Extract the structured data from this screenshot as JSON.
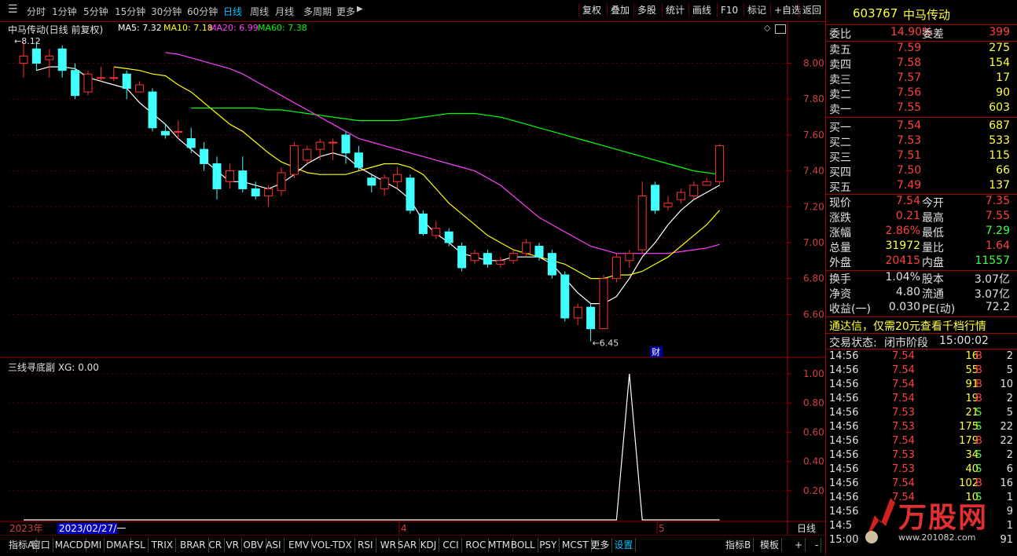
{
  "toolbar": {
    "periods": [
      "分时",
      "1分钟",
      "5分钟",
      "15分钟",
      "30分钟",
      "60分钟",
      "日线",
      "周线",
      "月线",
      "多周期",
      "更多"
    ],
    "active_period": "日线",
    "right_buttons": [
      "复权",
      "叠加",
      "多股",
      "统计",
      "画线",
      "F10",
      "标记",
      "+自选",
      "返回"
    ]
  },
  "chart": {
    "title": "中马传动(日线 前复权)",
    "ma_labels": [
      {
        "text": "MA5: 7.32",
        "color": "#ffffff"
      },
      {
        "text": "MA10: 7.18",
        "color": "#ffff00"
      },
      {
        "text": "MA20: 6.99",
        "color": "#ff40ff"
      },
      {
        "text": "MA60: 7.38",
        "color": "#00ff00"
      }
    ],
    "high_marker": "8.12",
    "low_marker": "6.45",
    "fin_marker": "财",
    "price_ticks": [
      "8.00",
      "7.80",
      "7.60",
      "7.40",
      "7.20",
      "7.00",
      "6.80",
      "6.60"
    ],
    "indicator_title": "三线寻底副 XG: 0.00",
    "ind_ticks": [
      "1.00",
      "0.80",
      "0.60",
      "0.40",
      "0.20"
    ],
    "date_year": "2023年",
    "date_cursor": "2023/02/27/一",
    "month_labels": [
      "4",
      "5"
    ],
    "period_tag": "日线",
    "chart_data": {
      "type": "candlestick",
      "ylim": [
        6.4,
        8.16
      ],
      "candles": [
        [
          8.0,
          8.04,
          7.92,
          8.12
        ],
        [
          8.08,
          8.0,
          7.96,
          8.12
        ],
        [
          8.02,
          8.04,
          7.92,
          8.08
        ],
        [
          8.08,
          7.96,
          7.92,
          8.1
        ],
        [
          7.96,
          7.82,
          7.8,
          8.0
        ],
        [
          7.84,
          7.94,
          7.82,
          7.96
        ],
        [
          7.92,
          7.92,
          7.9,
          7.98
        ],
        [
          7.92,
          7.92,
          7.9,
          7.98
        ],
        [
          7.94,
          7.86,
          7.8,
          7.96
        ],
        [
          7.84,
          7.88,
          7.84,
          7.9
        ],
        [
          7.84,
          7.64,
          7.62,
          7.86
        ],
        [
          7.62,
          7.6,
          7.58,
          7.66
        ],
        [
          7.62,
          7.62,
          7.58,
          7.68
        ],
        [
          7.58,
          7.53,
          7.5,
          7.64
        ],
        [
          7.52,
          7.44,
          7.4,
          7.56
        ],
        [
          7.44,
          7.3,
          7.24,
          7.48
        ],
        [
          7.34,
          7.4,
          7.3,
          7.44
        ],
        [
          7.4,
          7.3,
          7.28,
          7.48
        ],
        [
          7.3,
          7.26,
          7.24,
          7.34
        ],
        [
          7.26,
          7.3,
          7.2,
          7.32
        ],
        [
          7.29,
          7.39,
          7.26,
          7.42
        ],
        [
          7.38,
          7.54,
          7.36,
          7.56
        ],
        [
          7.46,
          7.52,
          7.44,
          7.54
        ],
        [
          7.52,
          7.56,
          7.46,
          7.58
        ],
        [
          7.56,
          7.56,
          7.46,
          7.58
        ],
        [
          7.6,
          7.5,
          7.44,
          7.62
        ],
        [
          7.5,
          7.42,
          7.4,
          7.54
        ],
        [
          7.36,
          7.32,
          7.28,
          7.38
        ],
        [
          7.3,
          7.36,
          7.26,
          7.38
        ],
        [
          7.34,
          7.38,
          7.3,
          7.42
        ],
        [
          7.36,
          7.18,
          7.16,
          7.38
        ],
        [
          7.16,
          7.05,
          7.04,
          7.18
        ],
        [
          7.04,
          7.08,
          7.02,
          7.12
        ],
        [
          7.06,
          7.0,
          6.98,
          7.08
        ],
        [
          6.98,
          6.86,
          6.84,
          7.0
        ],
        [
          6.9,
          6.94,
          6.88,
          6.96
        ],
        [
          6.94,
          6.88,
          6.86,
          6.96
        ],
        [
          6.88,
          6.9,
          6.86,
          6.92
        ],
        [
          6.9,
          6.94,
          6.88,
          6.96
        ],
        [
          6.94,
          7.0,
          6.92,
          7.02
        ],
        [
          6.98,
          6.92,
          6.9,
          7.0
        ],
        [
          6.94,
          6.82,
          6.8,
          6.96
        ],
        [
          6.82,
          6.58,
          6.56,
          6.84
        ],
        [
          6.58,
          6.64,
          6.54,
          6.66
        ],
        [
          6.64,
          6.52,
          6.45,
          6.66
        ],
        [
          6.52,
          6.8,
          6.52,
          6.82
        ],
        [
          6.8,
          6.92,
          6.78,
          6.94
        ],
        [
          6.9,
          6.94,
          6.86,
          6.96
        ],
        [
          6.96,
          7.26,
          6.94,
          7.34
        ],
        [
          7.32,
          7.18,
          7.16,
          7.34
        ],
        [
          7.2,
          7.22,
          7.18,
          7.26
        ],
        [
          7.24,
          7.28,
          7.22,
          7.3
        ],
        [
          7.26,
          7.32,
          7.24,
          7.34
        ],
        [
          7.32,
          7.34,
          7.32,
          7.36
        ],
        [
          7.34,
          7.54,
          7.32,
          7.55
        ]
      ],
      "ma5": [
        7.96,
        7.98,
        7.98,
        7.97,
        7.92,
        7.9,
        7.88,
        7.86,
        7.78,
        7.72,
        7.66,
        7.58,
        7.52,
        7.46,
        7.4,
        7.34,
        7.34,
        7.32,
        7.3,
        7.33,
        7.38,
        7.44,
        7.48,
        7.5,
        7.48,
        7.42,
        7.38,
        7.34,
        7.3,
        7.24,
        7.12,
        7.05,
        7.0,
        6.94,
        6.92,
        6.9,
        6.9,
        6.92,
        6.92,
        6.92,
        6.88,
        6.8,
        6.72,
        6.66,
        6.66,
        6.7,
        6.8,
        6.92,
        7.0,
        7.1,
        7.18,
        7.24,
        7.28,
        7.32
      ],
      "ma10": [
        7.98,
        7.97,
        7.96,
        7.94,
        7.93,
        7.88,
        7.84,
        7.78,
        7.72,
        7.66,
        7.62,
        7.56,
        7.5,
        7.45,
        7.42,
        7.39,
        7.38,
        7.38,
        7.38,
        7.4,
        7.42,
        7.44,
        7.44,
        7.42,
        7.38,
        7.3,
        7.22,
        7.16,
        7.1,
        7.04,
        7.0,
        6.96,
        6.94,
        6.92,
        6.9,
        6.88,
        6.84,
        6.8,
        6.8,
        6.82,
        6.82,
        6.84,
        6.88,
        6.92,
        6.98,
        7.04,
        7.1,
        7.18
      ],
      "ma20": [
        8.06,
        8.05,
        8.03,
        8.01,
        7.99,
        7.97,
        7.94,
        7.9,
        7.86,
        7.82,
        7.78,
        7.74,
        7.7,
        7.66,
        7.62,
        7.58,
        7.56,
        7.54,
        7.52,
        7.5,
        7.48,
        7.46,
        7.44,
        7.42,
        7.4,
        7.36,
        7.32,
        7.26,
        7.2,
        7.14,
        7.1,
        7.06,
        7.02,
        6.98,
        6.96,
        6.94,
        6.94,
        6.94,
        6.94,
        6.94,
        6.95,
        6.96,
        6.97,
        6.99
      ],
      "ma60": [
        7.75,
        7.75,
        7.75,
        7.75,
        7.75,
        7.75,
        7.74,
        7.74,
        7.73,
        7.72,
        7.71,
        7.7,
        7.69,
        7.68,
        7.68,
        7.68,
        7.68,
        7.69,
        7.7,
        7.71,
        7.72,
        7.72,
        7.72,
        7.71,
        7.7,
        7.68,
        7.66,
        7.64,
        7.62,
        7.6,
        7.58,
        7.56,
        7.54,
        7.52,
        7.5,
        7.48,
        7.46,
        7.44,
        7.42,
        7.4,
        7.39,
        7.38
      ],
      "xg": [
        0,
        0,
        0,
        0,
        0,
        0,
        0,
        0,
        0,
        0,
        0,
        0,
        0,
        0,
        0,
        0,
        0,
        0,
        0,
        0,
        0,
        0,
        0,
        0,
        0,
        0,
        0,
        0,
        0,
        0,
        0,
        0,
        0,
        0,
        0,
        0,
        0,
        0,
        0,
        0,
        0,
        0,
        0,
        0,
        0,
        0,
        0,
        1,
        0,
        0,
        0,
        0,
        0,
        0,
        0
      ]
    }
  },
  "tabs": [
    "指标A",
    "窗口",
    "MACD",
    "DMI",
    "DMA",
    "FSL",
    "TRIX",
    "BRAR",
    "CR",
    "VR",
    "OBV",
    "ASI",
    "EMV",
    "VOL-TDX",
    "RSI",
    "WR",
    "SAR",
    "KDJ",
    "CCI",
    "ROC",
    "MTM",
    "BOLL",
    "PSY",
    "MCST",
    "更多",
    "设置"
  ],
  "tabs_right": [
    "指标B",
    "模板",
    "+",
    "-"
  ],
  "panel": {
    "code": "603767",
    "name": "中马传动",
    "weibi_label": "委比",
    "weibi": "14.90%",
    "weicha_label": "委差",
    "weicha": "399",
    "sells": [
      {
        "label": "卖五",
        "price": "7.59",
        "vol": "275"
      },
      {
        "label": "卖四",
        "price": "7.58",
        "vol": "154"
      },
      {
        "label": "卖三",
        "price": "7.57",
        "vol": "17"
      },
      {
        "label": "卖二",
        "price": "7.56",
        "vol": "90"
      },
      {
        "label": "卖一",
        "price": "7.55",
        "vol": "603"
      }
    ],
    "buys": [
      {
        "label": "买一",
        "price": "7.54",
        "vol": "687"
      },
      {
        "label": "买二",
        "price": "7.53",
        "vol": "533"
      },
      {
        "label": "买三",
        "price": "7.51",
        "vol": "115"
      },
      {
        "label": "买四",
        "price": "7.50",
        "vol": "66"
      },
      {
        "label": "买五",
        "price": "7.49",
        "vol": "137"
      }
    ],
    "quote": [
      [
        {
          "k": "现价",
          "v": "7.54",
          "c": "#ff4040"
        },
        {
          "k": "今开",
          "v": "7.35",
          "c": "#ff4040"
        }
      ],
      [
        {
          "k": "涨跌",
          "v": "0.21",
          "c": "#ff4040"
        },
        {
          "k": "最高",
          "v": "7.55",
          "c": "#ff4040"
        }
      ],
      [
        {
          "k": "涨幅",
          "v": "2.86%",
          "c": "#ff4040"
        },
        {
          "k": "最低",
          "v": "7.29",
          "c": "#40ff40"
        }
      ],
      [
        {
          "k": "总量",
          "v": "31972",
          "c": "#ffff40"
        },
        {
          "k": "量比",
          "v": "1.64",
          "c": "#ff4040"
        }
      ],
      [
        {
          "k": "外盘",
          "v": "20415",
          "c": "#ff4040"
        },
        {
          "k": "内盘",
          "v": "11557",
          "c": "#40ff40"
        }
      ]
    ],
    "fund": [
      [
        {
          "k": "换手",
          "v": "1.04%"
        },
        {
          "k": "股本",
          "v": "3.07亿"
        }
      ],
      [
        {
          "k": "净资",
          "v": "4.80"
        },
        {
          "k": "流通",
          "v": "3.07亿"
        }
      ],
      [
        {
          "k": "收益(一)",
          "v": "0.030"
        },
        {
          "k": "PE(动)",
          "v": "72.2"
        }
      ]
    ],
    "ad": "通达信，仅需20元查看千档行情",
    "status_label": "交易状态:",
    "status": "闭市阶段",
    "status_time": "15:00:02",
    "trades": [
      [
        "14:56",
        "7.54",
        "16",
        "B",
        "2"
      ],
      [
        "14:56",
        "7.54",
        "55",
        "B",
        "5"
      ],
      [
        "14:56",
        "7.54",
        "91",
        "B",
        "10"
      ],
      [
        "14:56",
        "7.54",
        "19",
        "B",
        "2"
      ],
      [
        "14:56",
        "7.53",
        "21",
        "S",
        "5"
      ],
      [
        "14:56",
        "7.53",
        "175",
        "S",
        "22"
      ],
      [
        "14:56",
        "7.54",
        "179",
        "B",
        "22"
      ],
      [
        "14:56",
        "7.53",
        "34",
        "S",
        "2"
      ],
      [
        "14:56",
        "7.53",
        "40",
        "S",
        "6"
      ],
      [
        "14:56",
        "7.54",
        "102",
        "B",
        "16"
      ],
      [
        "14:56",
        "7.54",
        "10",
        "S",
        "1"
      ],
      [
        "14:56",
        "",
        "",
        "",
        "9"
      ],
      [
        "14:5",
        "",
        "",
        "",
        "1"
      ],
      [
        "15:00",
        "",
        "",
        "",
        "91"
      ]
    ],
    "logo_text": "万股网",
    "logo_url": "www.201082.com"
  }
}
